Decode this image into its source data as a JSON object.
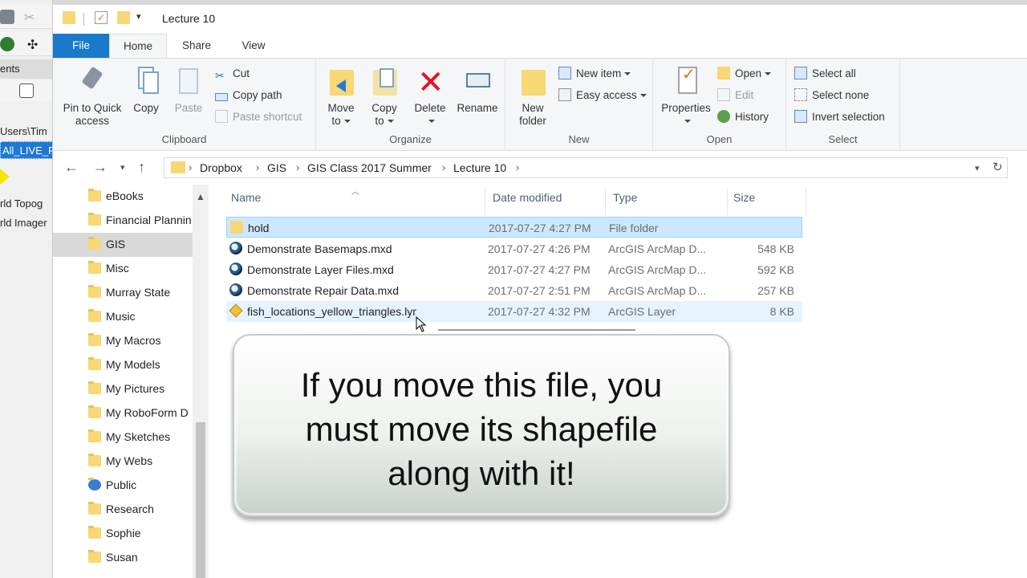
{
  "background_app": {
    "ribbon_label_fragment": "ents",
    "path_fragment": "Users\\Tim",
    "selected_layer_fragment": "All_LIVE_F",
    "layer_items": [
      "rld Topog",
      "rld Imager"
    ]
  },
  "window": {
    "title": "Lecture 10"
  },
  "tabs": [
    {
      "label": "File"
    },
    {
      "label": "Home"
    },
    {
      "label": "Share"
    },
    {
      "label": "View"
    }
  ],
  "ribbon": {
    "clipboard": {
      "label": "Clipboard",
      "pin_line1": "Pin to Quick",
      "pin_line2": "access",
      "copy": "Copy",
      "paste": "Paste",
      "cut": "Cut",
      "copy_path": "Copy path",
      "paste_shortcut": "Paste shortcut"
    },
    "organize": {
      "label": "Organize",
      "move_line1": "Move",
      "move_line2": "to",
      "copy_line1": "Copy",
      "copy_line2": "to",
      "delete": "Delete",
      "rename": "Rename"
    },
    "new": {
      "label": "New",
      "folder_line1": "New",
      "folder_line2": "folder",
      "new_item": "New item",
      "easy_access": "Easy access"
    },
    "open": {
      "label": "Open",
      "properties": "Properties",
      "open": "Open",
      "edit": "Edit",
      "history": "History"
    },
    "select": {
      "label": "Select",
      "select_all": "Select all",
      "select_none": "Select none",
      "invert": "Invert selection"
    }
  },
  "breadcrumb": [
    "Dropbox",
    "GIS",
    "GIS Class 2017 Summer",
    "Lecture 10"
  ],
  "nav_items": [
    {
      "label": "eBooks"
    },
    {
      "label": "Financial Plannin"
    },
    {
      "label": "GIS",
      "selected": true
    },
    {
      "label": "Misc"
    },
    {
      "label": "Murray State"
    },
    {
      "label": "Music"
    },
    {
      "label": "My Macros"
    },
    {
      "label": "My Models"
    },
    {
      "label": "My Pictures"
    },
    {
      "label": "My RoboForm D"
    },
    {
      "label": "My Sketches"
    },
    {
      "label": "My Webs"
    },
    {
      "label": "Public"
    },
    {
      "label": "Research"
    },
    {
      "label": "Sophie"
    },
    {
      "label": "Susan"
    }
  ],
  "columns": {
    "name": "Name",
    "date": "Date modified",
    "type": "Type",
    "size": "Size"
  },
  "files": [
    {
      "name": "hold",
      "date": "2017-07-27 4:27 PM",
      "type": "File folder",
      "size": "",
      "icon": "folder-icon"
    },
    {
      "name": "Demonstrate Basemaps.mxd",
      "date": "2017-07-27 4:26 PM",
      "type": "ArcGIS ArcMap D...",
      "size": "548 KB",
      "icon": "mxd-icon"
    },
    {
      "name": "Demonstrate Layer Files.mxd",
      "date": "2017-07-27 4:27 PM",
      "type": "ArcGIS ArcMap D...",
      "size": "592 KB",
      "icon": "mxd-icon"
    },
    {
      "name": "Demonstrate Repair Data.mxd",
      "date": "2017-07-27 2:51 PM",
      "type": "ArcGIS ArcMap D...",
      "size": "257 KB",
      "icon": "mxd-icon"
    },
    {
      "name": "fish_locations_yellow_triangles.lyr",
      "date": "2017-07-27 4:32 PM",
      "type": "ArcGIS Layer",
      "size": "8 KB",
      "icon": "lyr-icon"
    }
  ],
  "callout": {
    "line1": "If you move this file, you",
    "line2": "must move its shapefile",
    "line3": "along with it!"
  }
}
